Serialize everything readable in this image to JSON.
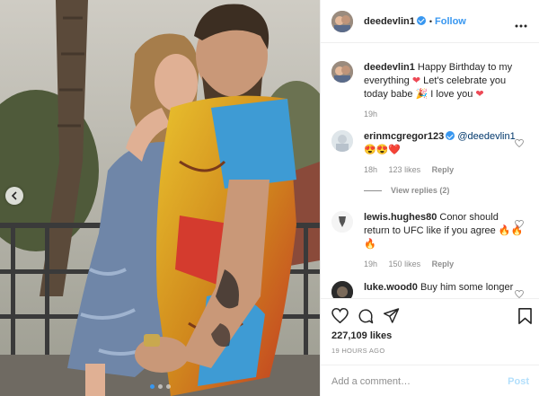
{
  "header": {
    "username": "deedevlin1",
    "separator": "•",
    "follow_label": "Follow",
    "more_icon": "more-horizontal-icon"
  },
  "caption": {
    "username": "deedevlin1",
    "text": "Happy Birthday to my everything ❤️ Let's celebrate you today babe 🎉 I love you ❤️",
    "text_parts": [
      "Happy Birthday to my everything ",
      " Let's celebrate you today babe ",
      " I love you "
    ],
    "time": "19h"
  },
  "comments": [
    {
      "username": "erinmcgregor123",
      "verified": true,
      "mention": "@deedevlin1",
      "text": "😍😍❤️",
      "time": "18h",
      "likes": "123 likes",
      "reply_label": "Reply",
      "view_replies": "View replies (2)"
    },
    {
      "username": "lewis.hughes80",
      "verified": false,
      "text": "Conor should return to UFC like if you agree 🔥🔥🔥",
      "text_main": "Conor should return to UFC like if you agree",
      "time": "19h",
      "likes": "150 likes",
      "reply_label": "Reply"
    },
    {
      "username": "luke.wood0",
      "verified": false,
      "text": "Buy him some longer"
    }
  ],
  "actions": {
    "like_icon": "heart-icon",
    "comment_icon": "comment-icon",
    "share_icon": "share-icon",
    "save_icon": "bookmark-icon",
    "likes_count": "227,109 likes",
    "posted_ago": "19 HOURS AGO"
  },
  "add_comment": {
    "placeholder": "Add a comment…",
    "post_label": "Post"
  },
  "carousel": {
    "current": 1,
    "total": 3
  },
  "colors": {
    "accent": "#3897f0",
    "heart": "#ed4956",
    "muted": "#8e8e8e",
    "post_disabled": "#b2dffc"
  }
}
